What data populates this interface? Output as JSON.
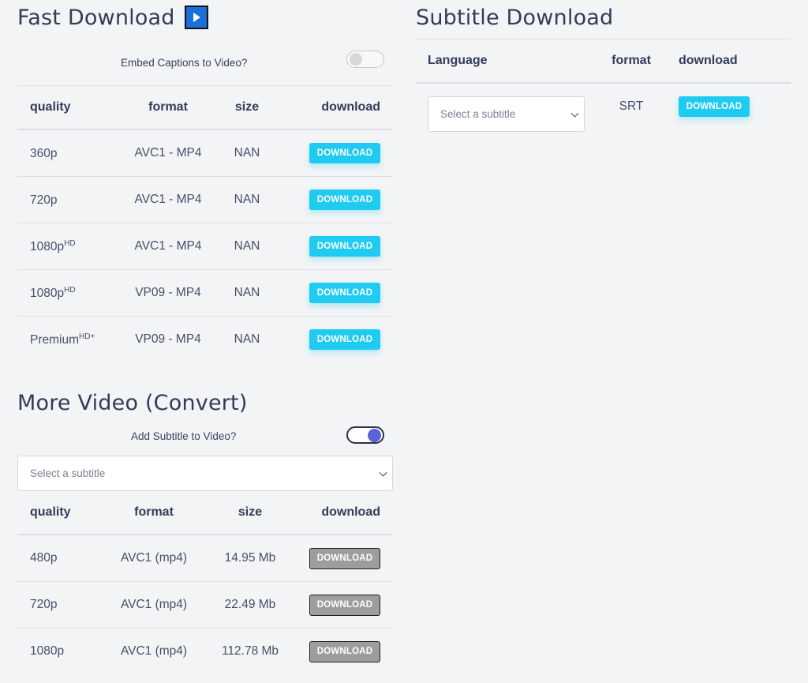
{
  "fast_download": {
    "title": "Fast Download",
    "play_icon": "play-icon",
    "embed_label": "Embed Captions to Video?",
    "embed_on": false,
    "headers": [
      "quality",
      "format",
      "size",
      "download"
    ],
    "rows": [
      {
        "quality": "360p",
        "sup": "",
        "format": "AVC1 - MP4",
        "size": "NAN",
        "button": "DOWNLOAD"
      },
      {
        "quality": "720p",
        "sup": "",
        "format": "AVC1 - MP4",
        "size": "NAN",
        "button": "DOWNLOAD"
      },
      {
        "quality": "1080p",
        "sup": "HD",
        "format": "AVC1 - MP4",
        "size": "NAN",
        "button": "DOWNLOAD"
      },
      {
        "quality": "1080p",
        "sup": "HD",
        "format": "VP09 - MP4",
        "size": "NAN",
        "button": "DOWNLOAD"
      },
      {
        "quality": "Premium",
        "sup": "HD+",
        "format": "VP09 - MP4",
        "size": "NAN",
        "button": "DOWNLOAD"
      }
    ]
  },
  "more_video": {
    "title": "More Video (Convert)",
    "subtitle_label": "Add Subtitle to Video?",
    "subtitle_on": true,
    "select_placeholder": "Select a subtitle",
    "headers": [
      "quality",
      "format",
      "size",
      "download"
    ],
    "rows": [
      {
        "quality": "480p",
        "format": "AVC1 (mp4)",
        "size": "14.95 Mb",
        "button": "DOWNLOAD"
      },
      {
        "quality": "720p",
        "format": "AVC1 (mp4)",
        "size": "22.49 Mb",
        "button": "DOWNLOAD"
      },
      {
        "quality": "1080p",
        "format": "AVC1 (mp4)",
        "size": "112.78 Mb",
        "button": "DOWNLOAD"
      }
    ]
  },
  "subtitle_download": {
    "title": "Subtitle Download",
    "headers": [
      "Language",
      "format",
      "download"
    ],
    "select_placeholder": "Select a subtitle",
    "format": "SRT",
    "button": "DOWNLOAD"
  },
  "colors": {
    "accent_cyan": "#1fcbf0",
    "disabled_gray": "#9d9d9d",
    "toggle_on": "#5a62d6",
    "play_blue": "#1a6fd8"
  }
}
